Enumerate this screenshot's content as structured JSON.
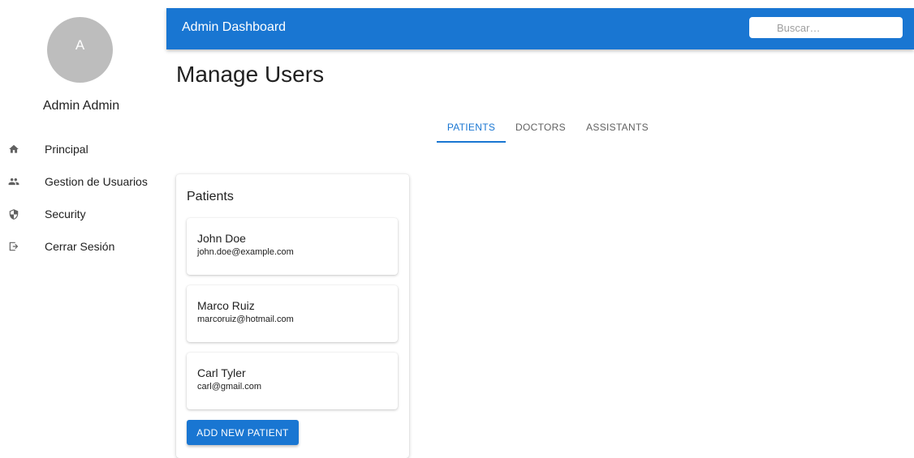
{
  "sidebar": {
    "avatar_initial": "A",
    "user_name": "Admin Admin",
    "items": [
      {
        "label": "Principal",
        "icon": "home-icon"
      },
      {
        "label": "Gestion de Usuarios",
        "icon": "people-icon"
      },
      {
        "label": "Security",
        "icon": "shield-icon"
      },
      {
        "label": "Cerrar Sesión",
        "icon": "logout-icon"
      }
    ]
  },
  "header": {
    "title": "Admin Dashboard",
    "search_placeholder": "Buscar…"
  },
  "main": {
    "page_title": "Manage Users",
    "tabs": [
      {
        "label": "Patients",
        "active": true
      },
      {
        "label": "Doctors",
        "active": false
      },
      {
        "label": "Assistants",
        "active": false
      }
    ],
    "card": {
      "title": "Patients",
      "patients": [
        {
          "name": "John Doe",
          "email": "john.doe@example.com"
        },
        {
          "name": "Marco Ruiz",
          "email": "marcoruiz@hotmail.com"
        },
        {
          "name": "Carl Tyler",
          "email": "carl@gmail.com"
        }
      ],
      "add_button_label": "ADD NEW PATIENT"
    }
  },
  "colors": {
    "primary": "#1976d2",
    "avatar_bg": "#bdbdbd",
    "text": "#212121",
    "muted_tab": "#616161"
  }
}
